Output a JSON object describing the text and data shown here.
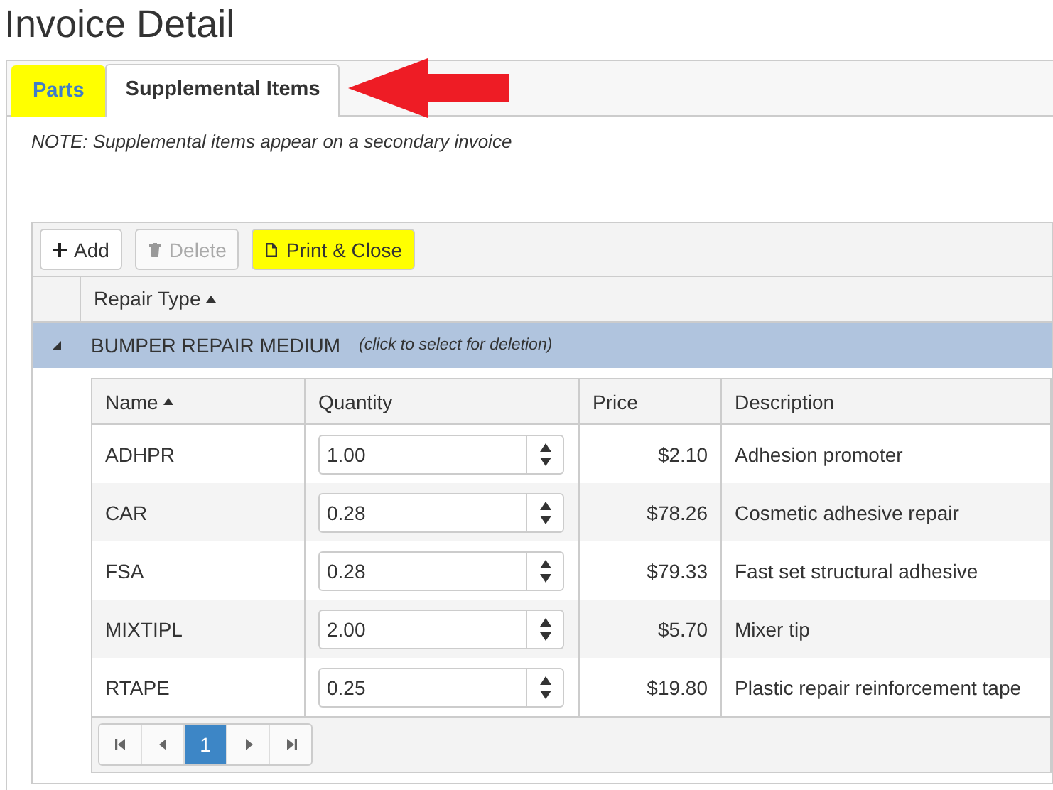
{
  "page": {
    "title": "Invoice Detail"
  },
  "tabs": [
    {
      "label": "Parts",
      "selected": false,
      "highlighted": true
    },
    {
      "label": "Supplemental Items",
      "selected": true,
      "highlighted": false
    }
  ],
  "note": "NOTE: Supplemental items appear on a secondary invoice",
  "toolbar": [
    {
      "label": "Add",
      "kind": "plus",
      "disabled": false,
      "highlighted": false
    },
    {
      "label": "Delete",
      "kind": "trash",
      "disabled": true,
      "highlighted": false
    },
    {
      "label": "Print & Close",
      "kind": "document",
      "disabled": false,
      "highlighted": true
    }
  ],
  "grid": {
    "columns": [
      {
        "label": "Repair Type",
        "sorted": true
      }
    ],
    "groups": [
      {
        "name": "BUMPER REPAIR MEDIUM",
        "hint": "(click to select for deletion)",
        "expanded": true,
        "selected": true,
        "detail": {
          "columns": [
            {
              "label": "Name",
              "sorted": true
            },
            {
              "label": "Quantity",
              "sorted": false
            },
            {
              "label": "Price",
              "sorted": false
            },
            {
              "label": "Description",
              "sorted": false
            }
          ],
          "rows": [
            {
              "name": "ADHPR",
              "quantity": "1.00",
              "price": "$2.10",
              "description": "Adhesion promoter"
            },
            {
              "name": "CAR",
              "quantity": "0.28",
              "price": "$78.26",
              "description": "Cosmetic adhesive repair"
            },
            {
              "name": "FSA",
              "quantity": "0.28",
              "price": "$79.33",
              "description": "Fast set structural adhesive"
            },
            {
              "name": "MIXTIPL",
              "quantity": "2.00",
              "price": "$5.70",
              "description": "Mixer tip"
            },
            {
              "name": "RTAPE",
              "quantity": "0.25",
              "price": "$19.80",
              "description": "Plastic repair reinforcement tape"
            }
          ],
          "pager": {
            "pages": [
              {
                "label": "1",
                "selected": true
              }
            ]
          }
        }
      }
    ]
  }
}
